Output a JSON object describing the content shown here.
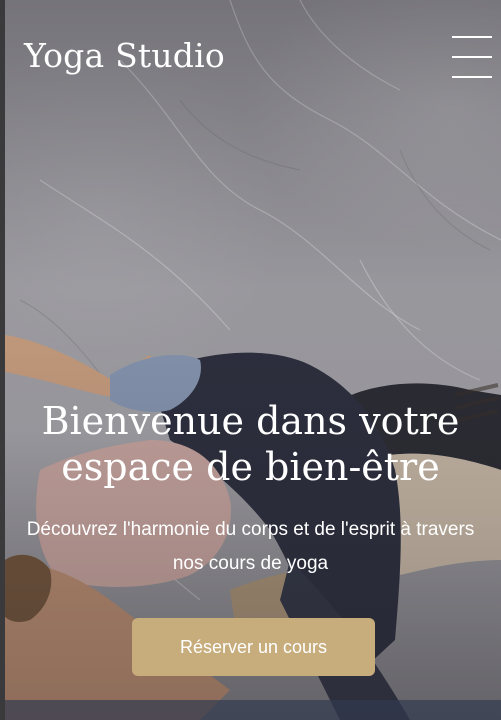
{
  "header": {
    "brand": "Yoga Studio",
    "menu_icon": "hamburger-menu-icon"
  },
  "hero": {
    "title": "Bienvenue dans votre espace de bien-être",
    "subtitle": "Découvrez l'harmonie du corps et de l'esprit à travers nos cours de yoga",
    "cta_label": "Réserver un cours",
    "background": "yoga-class-photo"
  },
  "colors": {
    "accent": "#c7ac7c",
    "text": "#ffffff"
  }
}
